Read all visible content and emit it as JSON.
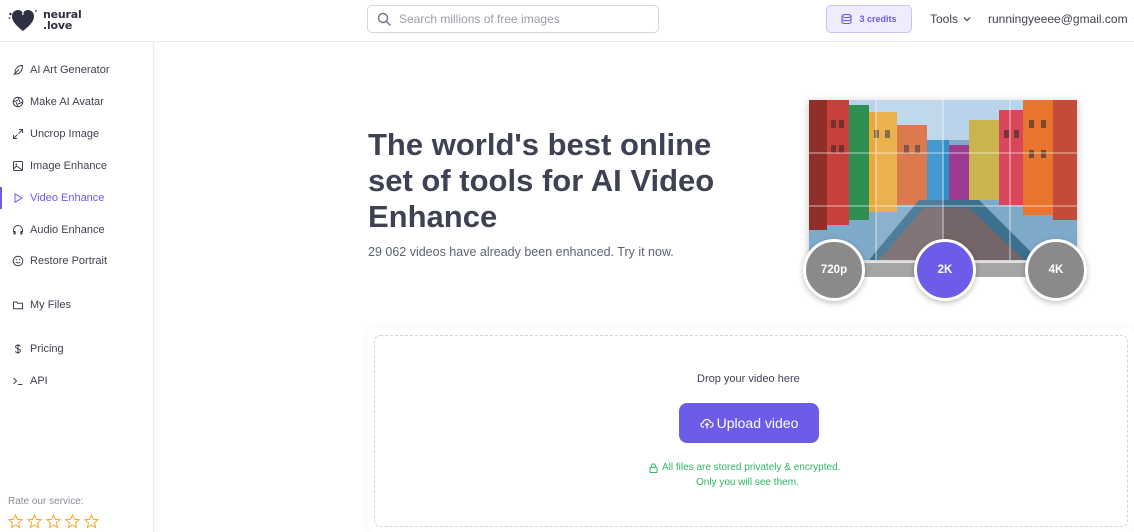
{
  "brand": {
    "line1": "neural",
    "line2": ".love"
  },
  "search": {
    "placeholder": "Search millions of free images"
  },
  "header": {
    "credits_label": "3 credits",
    "tools_label": "Tools",
    "account_email": "runningyeeee@gmail.com"
  },
  "sidebar": {
    "items": [
      {
        "label": "AI Art Generator",
        "icon": "feather-icon"
      },
      {
        "label": "Make AI Avatar",
        "icon": "aperture-icon"
      },
      {
        "label": "Uncrop Image",
        "icon": "expand-icon"
      },
      {
        "label": "Image Enhance",
        "icon": "image-icon"
      },
      {
        "label": "Video Enhance",
        "icon": "play-icon",
        "active": true
      },
      {
        "label": "Audio Enhance",
        "icon": "headphones-icon"
      },
      {
        "label": "Restore Portrait",
        "icon": "smile-icon"
      },
      {
        "label": "My Files",
        "icon": "folder-icon"
      },
      {
        "label": "Pricing",
        "icon": "dollar-icon"
      },
      {
        "label": "API",
        "icon": "terminal-icon"
      }
    ],
    "rate_label": "Rate our service:",
    "rating_stars": 5
  },
  "hero": {
    "title": "The world's best online set of tools for AI Video Enhance",
    "subtitle": "29 062 videos have already been enhanced. Try it now."
  },
  "resolutions": [
    "720p",
    "2K",
    "4K"
  ],
  "upload": {
    "drop_label": "Drop your video here",
    "button_label": "Upload video",
    "secure_line1": "All files are stored privately & encrypted.",
    "secure_line2": "Only you will see them."
  },
  "colors": {
    "accent": "#6c5ce7",
    "text": "#3f4254",
    "secure": "#2fb563",
    "credits_bg": "#eeecfd"
  }
}
